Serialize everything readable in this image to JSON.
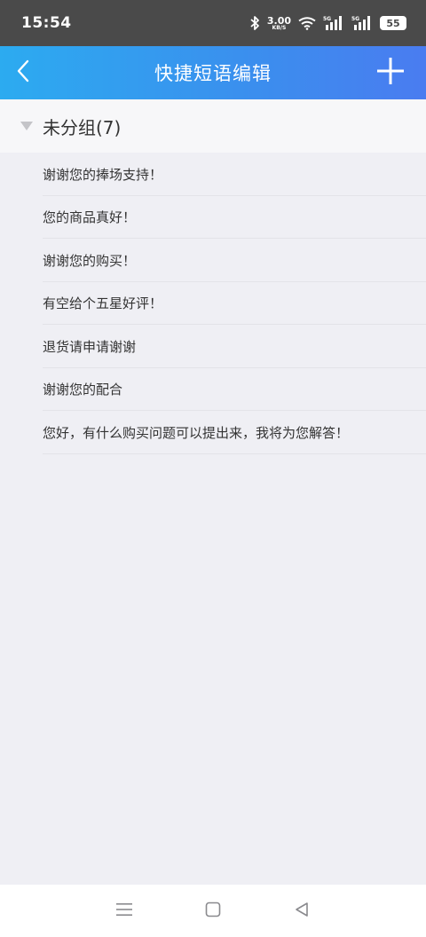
{
  "status_bar": {
    "time": "15:54",
    "net_speed_value": "3.00",
    "net_speed_unit": "KB/S",
    "sim1_label": "5G",
    "sim2_label": "5G",
    "battery_level": "55",
    "icons": [
      "bluetooth-icon",
      "wifi-icon",
      "signal-icon",
      "battery-icon"
    ]
  },
  "header": {
    "title": "快捷短语编辑",
    "back_icon": "chevron-left-icon",
    "add_icon": "plus-icon",
    "gradient_start": "#2cabf0",
    "gradient_end": "#4a7cf0"
  },
  "group": {
    "title": "未分组(7)",
    "expand_icon": "triangle-down-icon"
  },
  "phrases": [
    "谢谢您的捧场支持！",
    "您的商品真好！",
    "谢谢您的购买！",
    "有空给个五星好评！",
    "退货请申请谢谢",
    "谢谢您的配合",
    "您好，有什么购买问题可以提出来，我将为您解答！"
  ],
  "nav_bar": {
    "icons": [
      "menu-icon",
      "home-icon",
      "back-icon"
    ]
  }
}
